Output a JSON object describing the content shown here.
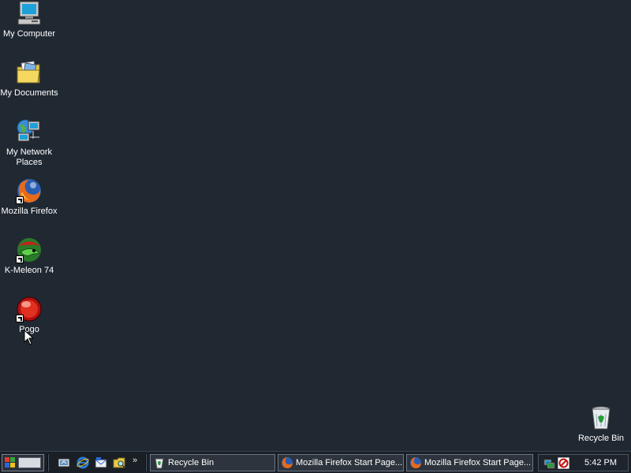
{
  "desktop": {
    "icons": [
      {
        "label": "My Computer",
        "icon": "my-computer-icon"
      },
      {
        "label": "My Documents",
        "icon": "folder-icon"
      },
      {
        "label": "My Network Places",
        "icon": "network-places-icon"
      },
      {
        "label": "Mozilla Firefox",
        "icon": "firefox-icon"
      },
      {
        "label": "K-Meleon 74",
        "icon": "k-meleon-icon"
      },
      {
        "label": "Pogo",
        "icon": "pogo-icon"
      },
      {
        "label": "Recycle Bin",
        "icon": "recycle-bin-icon"
      }
    ]
  },
  "taskbar": {
    "more_glyph": "»",
    "tasks": [
      {
        "label": "Recycle Bin",
        "icon": "recycle-bin-icon"
      },
      {
        "label": "Mozilla Firefox Start Page...",
        "icon": "firefox-icon"
      },
      {
        "label": "Mozilla Firefox Start Page...",
        "icon": "firefox-icon"
      }
    ],
    "clock": "5:42 PM"
  },
  "colors": {
    "desktop_bg": "#202832",
    "taskbar_bg": "#1a1f26"
  }
}
